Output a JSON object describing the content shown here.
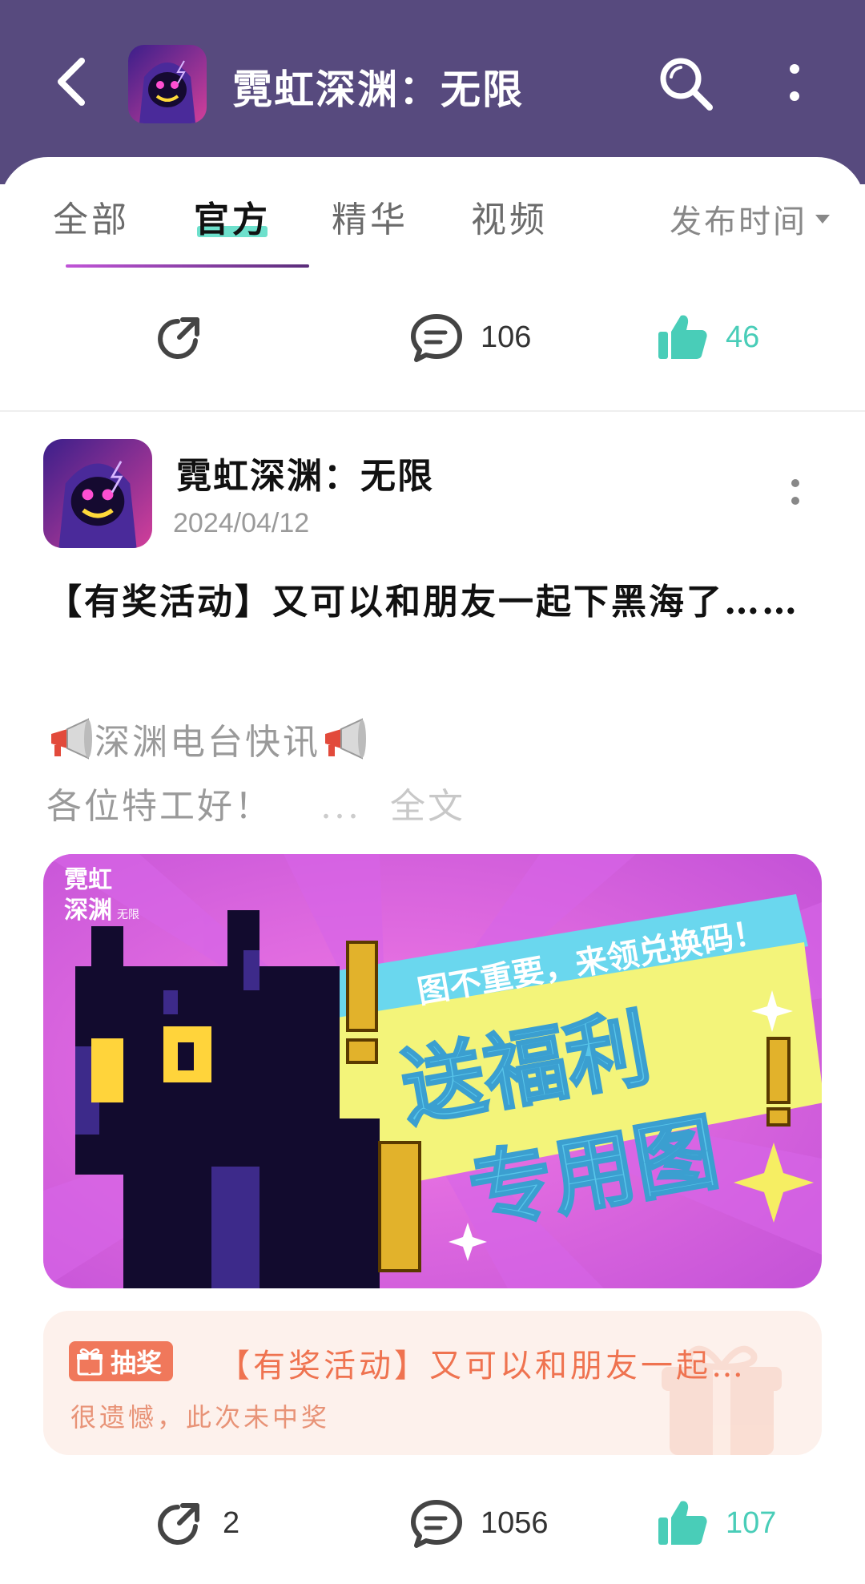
{
  "header": {
    "title": "霓虹深渊：无限",
    "back_icon": "chevron-left-icon",
    "search_icon": "search-icon",
    "more_icon": "more-vertical-icon"
  },
  "tabs": {
    "items": [
      {
        "label": "全部"
      },
      {
        "label": "官方"
      },
      {
        "label": "精华"
      },
      {
        "label": "视频"
      }
    ],
    "active": "官方",
    "sort_label": "发布时间"
  },
  "prev_post": {
    "comments": "106",
    "likes": "46"
  },
  "post": {
    "author": "霓虹深渊：无限",
    "date": "2024/04/12",
    "title": "【有奖活动】又可以和朋友一起下黑海了……",
    "body_line1": "深渊电台快讯",
    "body_line2": "各位特工好！",
    "ellipsis": "...",
    "full_text": "全文",
    "banner": {
      "logo_line1": "霓虹",
      "logo_line2": "深渊",
      "logo_suffix": "无限",
      "ribbon_text": "图不重要，来领兑换码！",
      "main_line1": "送福利",
      "main_line2": "专用图"
    },
    "lottery": {
      "badge": "抽奖",
      "title": "【有奖活动】又可以和朋友一起…",
      "status": "很遗憾，此次未中奖"
    },
    "shares": "2",
    "comments": "1056",
    "likes": "107"
  },
  "colors": {
    "header_bg": "#574a7e",
    "accent_teal": "#49cdb8",
    "lottery_orange": "#ef7350"
  }
}
